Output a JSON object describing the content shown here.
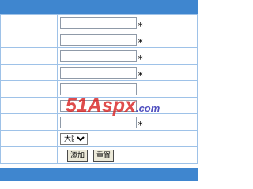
{
  "form": {
    "rows": [
      {
        "value": "",
        "required_mark": "*"
      },
      {
        "value": "",
        "required_mark": "*"
      },
      {
        "value": "",
        "required_mark": "*"
      },
      {
        "value": "",
        "required_mark": "*"
      },
      {
        "value": "",
        "required_mark": ""
      },
      {
        "value": "",
        "required_mark": ""
      },
      {
        "value": "",
        "required_mark": "*"
      }
    ],
    "select": {
      "selected": "大区",
      "options": [
        "大区"
      ]
    },
    "buttons": {
      "add_label": "添加",
      "reset_label": "重置"
    }
  },
  "watermark": {
    "main": "51Aspx",
    "suffix": ".com"
  },
  "colors": {
    "header_bar": "#3f86cf",
    "grid_border": "#9ec2e8",
    "watermark_red": "#d92525",
    "watermark_blue": "#2b2bb3"
  }
}
